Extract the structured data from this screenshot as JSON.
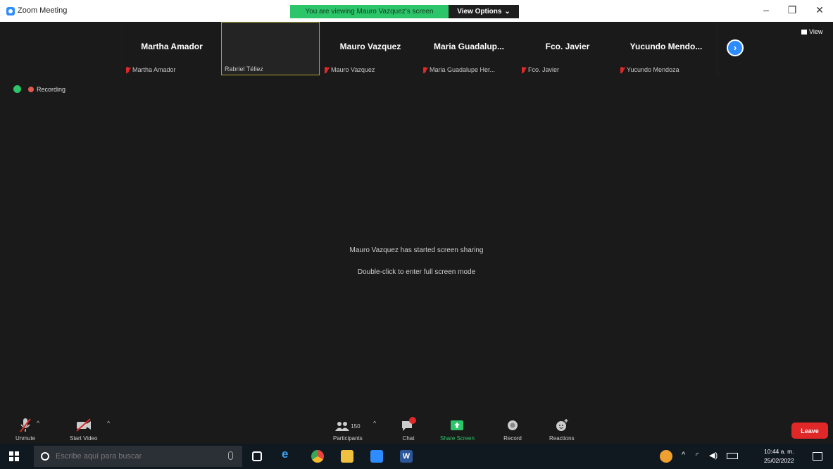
{
  "window": {
    "title": "Zoom Meeting",
    "share_banner": "You are viewing Mauro Vazquez's screen",
    "view_options": "View Options",
    "view_button": "View"
  },
  "participants": [
    {
      "big": "Martha Amador",
      "small": "Martha Amador",
      "muted": true
    },
    {
      "big": "",
      "small": "Rabriel Téllez",
      "muted": false
    },
    {
      "big": "Mauro Vazquez",
      "small": "Mauro Vazquez",
      "muted": true
    },
    {
      "big": "Maria  Guadalup...",
      "small": "Maria Guadalupe Her...",
      "muted": true
    },
    {
      "big": "Fco. Javier",
      "small": "Fco. Javier",
      "muted": true
    },
    {
      "big": "Yucundo  Mendo...",
      "small": "Yucundo Mendoza",
      "muted": true
    }
  ],
  "status": {
    "recording": "Recording"
  },
  "share": {
    "message": "Mauro Vazquez has started screen sharing",
    "hint": "Double-click to enter full screen mode"
  },
  "toolbar": {
    "unmute": "Unmute",
    "start_video": "Start Video",
    "participants": "Participants",
    "participants_count": "150",
    "chat": "Chat",
    "share_screen": "Share Screen",
    "record": "Record",
    "reactions": "Reactions",
    "leave": "Leave"
  },
  "taskbar": {
    "search_placeholder": "Escribe aquí para buscar",
    "time": "10:44 a. m.",
    "date": "25/02/2022"
  },
  "colors": {
    "zoom_blue": "#2d8cff",
    "banner_green": "#2dc56a",
    "leave_red": "#e02828",
    "muted_red": "#e02828"
  }
}
